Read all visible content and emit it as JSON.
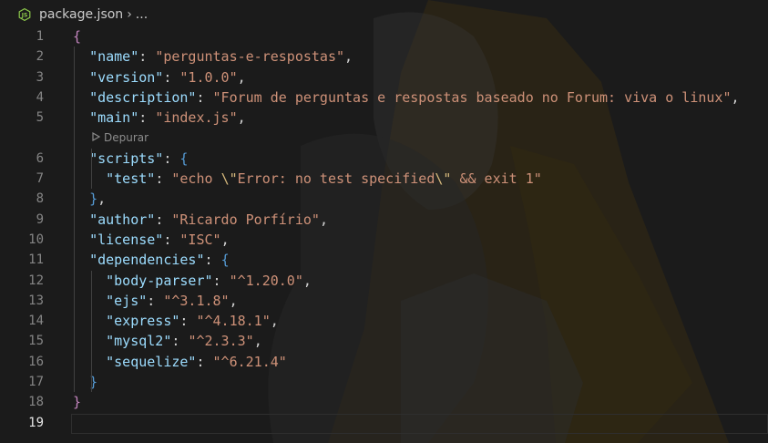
{
  "breadcrumb": {
    "icon": "nodejs-icon",
    "file": "package.json",
    "separator": "›",
    "more": "..."
  },
  "codelens": {
    "debug_label": "Depurar",
    "icon": "debug-play-icon"
  },
  "editor": {
    "active_line": 19,
    "line_numbers": [
      "1",
      "2",
      "3",
      "4",
      "5",
      "6",
      "7",
      "8",
      "9",
      "10",
      "11",
      "12",
      "13",
      "14",
      "15",
      "16",
      "17",
      "18",
      "19"
    ],
    "lines": [
      [
        {
          "t": "{",
          "c": "b1"
        }
      ],
      [
        {
          "t": "  ",
          "c": "p"
        },
        {
          "t": "\"name\"",
          "c": "k"
        },
        {
          "t": ": ",
          "c": "p"
        },
        {
          "t": "\"perguntas-e-respostas\"",
          "c": "s"
        },
        {
          "t": ",",
          "c": "p"
        }
      ],
      [
        {
          "t": "  ",
          "c": "p"
        },
        {
          "t": "\"version\"",
          "c": "k"
        },
        {
          "t": ": ",
          "c": "p"
        },
        {
          "t": "\"1.0.0\"",
          "c": "s"
        },
        {
          "t": ",",
          "c": "p"
        }
      ],
      [
        {
          "t": "  ",
          "c": "p"
        },
        {
          "t": "\"description\"",
          "c": "k"
        },
        {
          "t": ": ",
          "c": "p"
        },
        {
          "t": "\"Forum de perguntas e respostas baseado no Forum: viva o linux\"",
          "c": "s"
        },
        {
          "t": ",",
          "c": "p"
        }
      ],
      [
        {
          "t": "  ",
          "c": "p"
        },
        {
          "t": "\"main\"",
          "c": "k"
        },
        {
          "t": ": ",
          "c": "p"
        },
        {
          "t": "\"index.js\"",
          "c": "s"
        },
        {
          "t": ",",
          "c": "p"
        }
      ],
      [
        {
          "t": "  ",
          "c": "p"
        },
        {
          "t": "\"scripts\"",
          "c": "k"
        },
        {
          "t": ": ",
          "c": "p"
        },
        {
          "t": "{",
          "c": "b2"
        }
      ],
      [
        {
          "t": "    ",
          "c": "p"
        },
        {
          "t": "\"test\"",
          "c": "k"
        },
        {
          "t": ": ",
          "c": "p"
        },
        {
          "t": "\"echo ",
          "c": "s"
        },
        {
          "t": "\\\"",
          "c": "e"
        },
        {
          "t": "Error: no test specified",
          "c": "s"
        },
        {
          "t": "\\\"",
          "c": "e"
        },
        {
          "t": " && exit 1\"",
          "c": "s"
        }
      ],
      [
        {
          "t": "  ",
          "c": "p"
        },
        {
          "t": "}",
          "c": "b2"
        },
        {
          "t": ",",
          "c": "p"
        }
      ],
      [
        {
          "t": "  ",
          "c": "p"
        },
        {
          "t": "\"author\"",
          "c": "k"
        },
        {
          "t": ": ",
          "c": "p"
        },
        {
          "t": "\"Ricardo Porfírio\"",
          "c": "s"
        },
        {
          "t": ",",
          "c": "p"
        }
      ],
      [
        {
          "t": "  ",
          "c": "p"
        },
        {
          "t": "\"license\"",
          "c": "k"
        },
        {
          "t": ": ",
          "c": "p"
        },
        {
          "t": "\"ISC\"",
          "c": "s"
        },
        {
          "t": ",",
          "c": "p"
        }
      ],
      [
        {
          "t": "  ",
          "c": "p"
        },
        {
          "t": "\"dependencies\"",
          "c": "k"
        },
        {
          "t": ": ",
          "c": "p"
        },
        {
          "t": "{",
          "c": "b2"
        }
      ],
      [
        {
          "t": "    ",
          "c": "p"
        },
        {
          "t": "\"body-parser\"",
          "c": "k"
        },
        {
          "t": ": ",
          "c": "p"
        },
        {
          "t": "\"^1.20.0\"",
          "c": "s"
        },
        {
          "t": ",",
          "c": "p"
        }
      ],
      [
        {
          "t": "    ",
          "c": "p"
        },
        {
          "t": "\"ejs\"",
          "c": "k"
        },
        {
          "t": ": ",
          "c": "p"
        },
        {
          "t": "\"^3.1.8\"",
          "c": "s"
        },
        {
          "t": ",",
          "c": "p"
        }
      ],
      [
        {
          "t": "    ",
          "c": "p"
        },
        {
          "t": "\"express\"",
          "c": "k"
        },
        {
          "t": ": ",
          "c": "p"
        },
        {
          "t": "\"^4.18.1\"",
          "c": "s"
        },
        {
          "t": ",",
          "c": "p"
        }
      ],
      [
        {
          "t": "    ",
          "c": "p"
        },
        {
          "t": "\"mysql2\"",
          "c": "k"
        },
        {
          "t": ": ",
          "c": "p"
        },
        {
          "t": "\"^2.3.3\"",
          "c": "s"
        },
        {
          "t": ",",
          "c": "p"
        }
      ],
      [
        {
          "t": "    ",
          "c": "p"
        },
        {
          "t": "\"sequelize\"",
          "c": "k"
        },
        {
          "t": ": ",
          "c": "p"
        },
        {
          "t": "\"^6.21.4\"",
          "c": "s"
        }
      ],
      [
        {
          "t": "  ",
          "c": "p"
        },
        {
          "t": "}",
          "c": "b2"
        }
      ],
      [
        {
          "t": "}",
          "c": "b1"
        }
      ],
      []
    ]
  },
  "colors": {
    "background": "#1b1b1b",
    "key": "#9cdcfe",
    "string": "#ce9178",
    "escape": "#d7ba7d",
    "bracket_level1": "#c586c0",
    "bracket_level2": "#569cd6",
    "nodejs_icon": "#8cc84b"
  }
}
